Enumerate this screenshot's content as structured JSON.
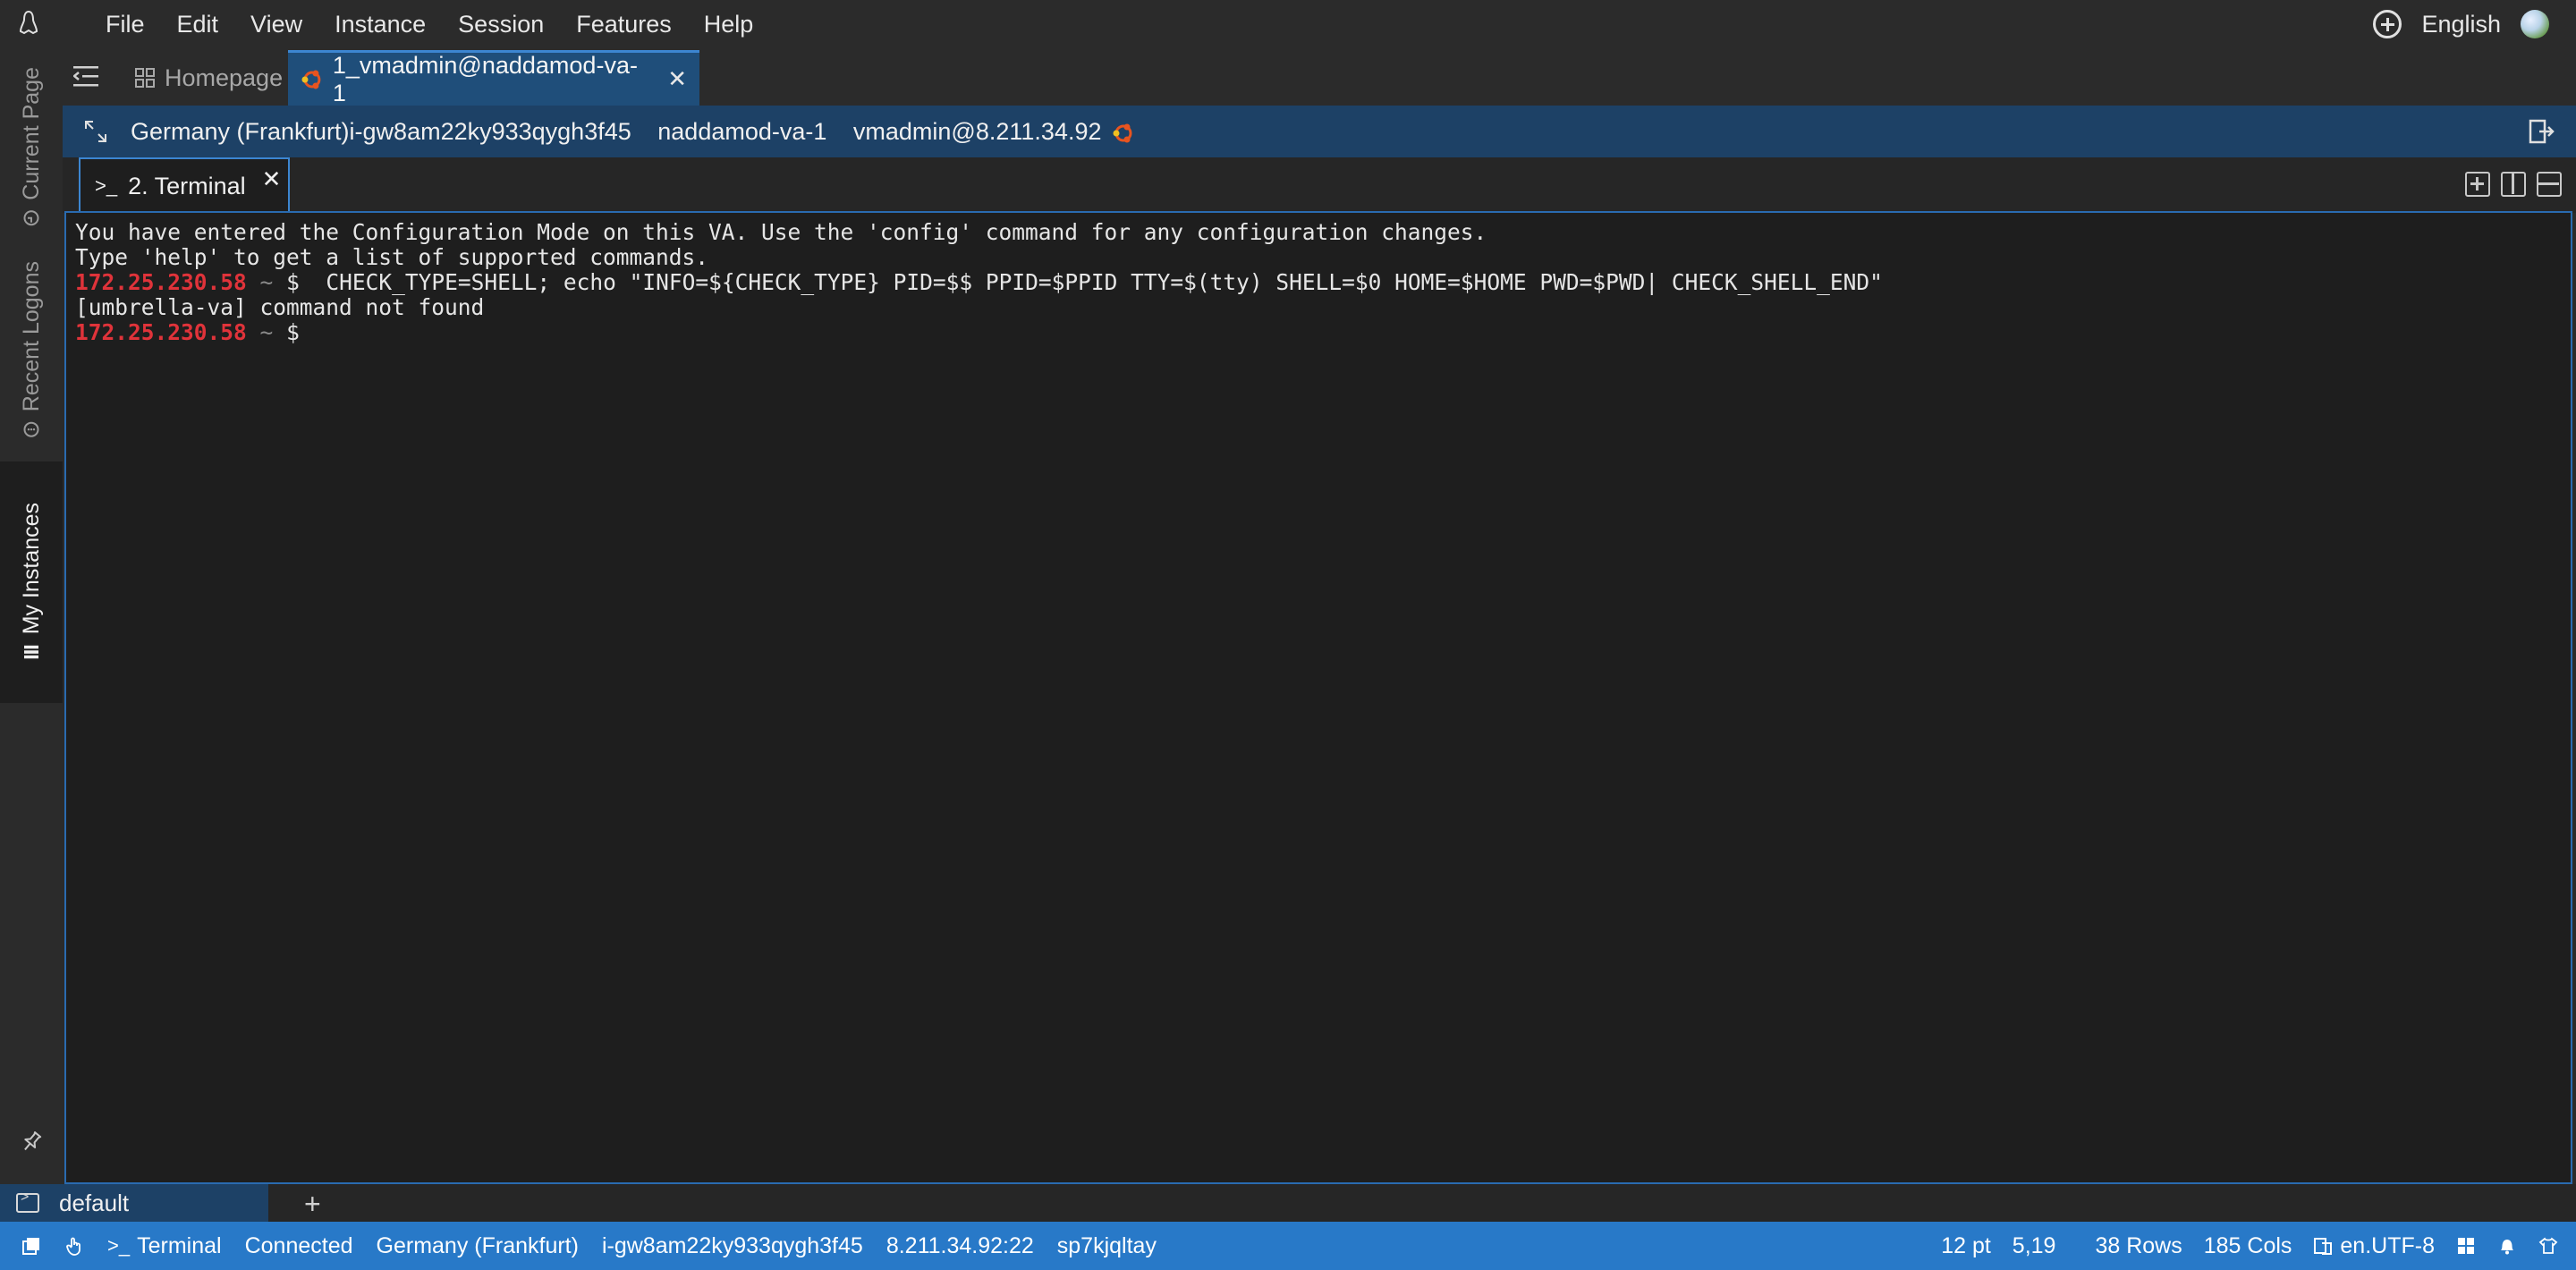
{
  "menubar": {
    "items": [
      "File",
      "Edit",
      "View",
      "Instance",
      "Session",
      "Features",
      "Help"
    ],
    "language": "English"
  },
  "sidebar": {
    "tabs": [
      "Current Page",
      "Recent Logons",
      "My Instances"
    ]
  },
  "tabs": {
    "home_label": "Homepage",
    "session_label": "1_vmadmin@naddamod-va-1",
    "close_glyph": "✕"
  },
  "infobar": {
    "region_instance": "Germany (Frankfurt)i-gw8am22ky933qygh3f45",
    "hostname": "naddamod-va-1",
    "user_host": "vmadmin@8.211.34.92"
  },
  "terminal_tab": {
    "label": "2. Terminal",
    "prompt_glyph": ">_"
  },
  "terminal": {
    "line1": "You have entered the Configuration Mode on this VA. Use the 'config' command for any configuration changes.",
    "line2": "Type 'help' to get a list of supported commands.",
    "prompt_ip": "172.25.230.58",
    "prompt_tilde": "~",
    "prompt_dollar": "$",
    "command": "  CHECK_TYPE=SHELL; echo \"INFO=${CHECK_TYPE} PID=$$ PPID=$PPID TTY=$(tty) SHELL=$0 HOME=$HOME PWD=$PWD| CHECK_SHELL_END\"",
    "output": "[umbrella-va] command not found"
  },
  "session_bar": {
    "name": "default",
    "add_glyph": "+"
  },
  "statusbar": {
    "terminal": "Terminal",
    "status": "Connected",
    "region": "Germany (Frankfurt)",
    "instance_id": "i-gw8am22ky933qygh3f45",
    "address": "8.211.34.92:22",
    "session_id": "sp7kjqltay",
    "font_size": "12 pt",
    "cursor": "5,19",
    "rows": "38 Rows",
    "cols": "185 Cols",
    "encoding": "en.UTF-8"
  },
  "colors": {
    "accent": "#2879c8",
    "infobar": "#1d4166",
    "prompt_ip": "#e0333a",
    "terminal_bg": "#1e1e1e"
  }
}
